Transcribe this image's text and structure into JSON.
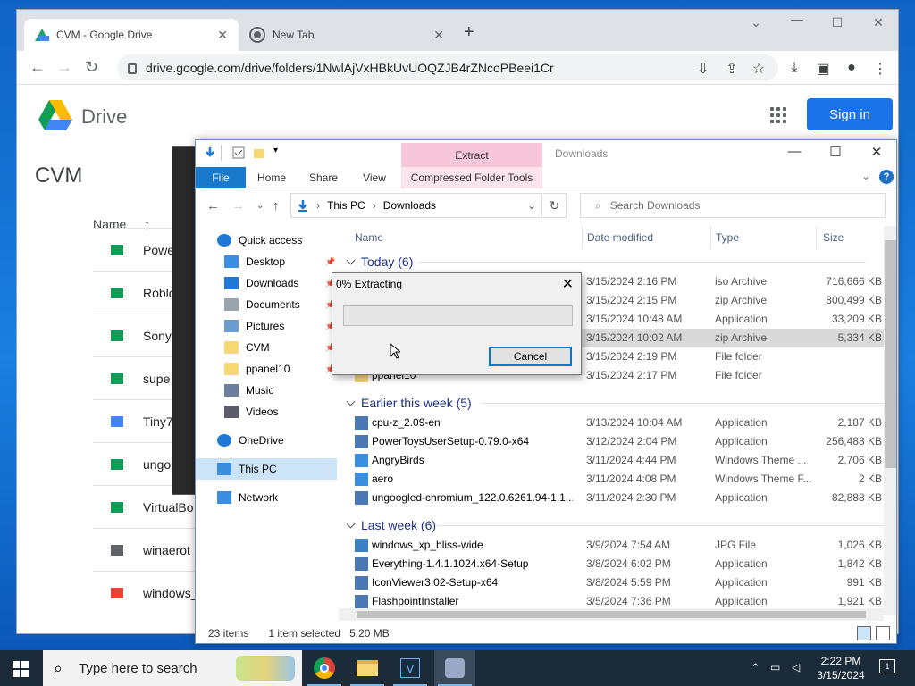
{
  "browser": {
    "tabs": [
      {
        "title": "CVM - Google Drive",
        "active": true
      },
      {
        "title": "New Tab",
        "active": false
      }
    ],
    "url": "drive.google.com/drive/folders/1NwlAjVxHBkUvUOQZJB4rZNcoPBeei1Cr",
    "drive": {
      "product": "Drive",
      "sign_in": "Sign in",
      "folder": "CVM",
      "name_header": "Name",
      "sort_arrow": "↑",
      "rows": [
        "Powe",
        "Roblo",
        "Sony",
        "supe",
        "Tiny7",
        "ungo",
        "VirtualBo",
        "winaerot",
        "windows_"
      ]
    }
  },
  "explorer": {
    "title": "Downloads",
    "context_tab": "Extract",
    "ribbon_tabs": [
      "File",
      "Home",
      "Share",
      "View",
      "Compressed Folder Tools"
    ],
    "address": [
      "This PC",
      "Downloads"
    ],
    "search_placeholder": "Search Downloads",
    "columns": {
      "name": "Name",
      "date": "Date modified",
      "type": "Type",
      "size": "Size"
    },
    "sidebar": [
      {
        "label": "Quick access",
        "icon": "star-icon"
      },
      {
        "label": "Desktop",
        "icon": "desktop-icon",
        "pinned": true
      },
      {
        "label": "Downloads",
        "icon": "download-icon",
        "pinned": true
      },
      {
        "label": "Documents",
        "icon": "documents-icon",
        "pinned": true
      },
      {
        "label": "Pictures",
        "icon": "pictures-icon",
        "pinned": true
      },
      {
        "label": "CVM",
        "icon": "folder-icon",
        "pinned": true
      },
      {
        "label": "ppanel10",
        "icon": "folder-icon",
        "pinned": true
      },
      {
        "label": "Music",
        "icon": "music-icon"
      },
      {
        "label": "Videos",
        "icon": "videos-icon"
      },
      {
        "label": "OneDrive",
        "icon": "cloud-icon"
      },
      {
        "label": "This PC",
        "icon": "pc-icon",
        "selected": true
      },
      {
        "label": "Network",
        "icon": "network-icon"
      }
    ],
    "groups": [
      {
        "label": "Today (6)",
        "rows": [
          {
            "name": "",
            "date": "3/15/2024 2:16 PM",
            "type": "iso Archive",
            "size": "716,666 KB",
            "icon": "archive"
          },
          {
            "name": "",
            "date": "3/15/2024 2:15 PM",
            "type": "zip Archive",
            "size": "800,499 KB",
            "icon": "archive"
          },
          {
            "name": "",
            "date": "3/15/2024 10:48 AM",
            "type": "Application",
            "size": "33,209 KB",
            "icon": "app"
          },
          {
            "name": "",
            "date": "3/15/2024 10:02 AM",
            "type": "zip Archive",
            "size": "5,334 KB",
            "icon": "archive",
            "selected": true
          },
          {
            "name": "",
            "date": "3/15/2024 2:19 PM",
            "type": "File folder",
            "size": "",
            "icon": "folder"
          },
          {
            "name": "ppanel10",
            "date": "3/15/2024 2:17 PM",
            "type": "File folder",
            "size": "",
            "icon": "folder"
          }
        ]
      },
      {
        "label": "Earlier this week (5)",
        "rows": [
          {
            "name": "cpu-z_2.09-en",
            "date": "3/13/2024 10:04 AM",
            "type": "Application",
            "size": "2,187 KB",
            "icon": "app"
          },
          {
            "name": "PowerToysUserSetup-0.79.0-x64",
            "date": "3/12/2024 2:04 PM",
            "type": "Application",
            "size": "256,488 KB",
            "icon": "app"
          },
          {
            "name": "AngryBirds",
            "date": "3/11/2024 4:44 PM",
            "type": "Windows Theme ...",
            "size": "2,706 KB",
            "icon": "theme"
          },
          {
            "name": "aero",
            "date": "3/11/2024 4:08 PM",
            "type": "Windows Theme F...",
            "size": "2 KB",
            "icon": "theme"
          },
          {
            "name": "ungoogled-chromium_122.0.6261.94-1.1...",
            "date": "3/11/2024 2:30 PM",
            "type": "Application",
            "size": "82,888 KB",
            "icon": "app"
          }
        ]
      },
      {
        "label": "Last week (6)",
        "rows": [
          {
            "name": "windows_xp_bliss-wide",
            "date": "3/9/2024 7:54 AM",
            "type": "JPG File",
            "size": "1,026 KB",
            "icon": "image"
          },
          {
            "name": "Everything-1.4.1.1024.x64-Setup",
            "date": "3/8/2024 6:02 PM",
            "type": "Application",
            "size": "1,842 KB",
            "icon": "app"
          },
          {
            "name": "IconViewer3.02-Setup-x64",
            "date": "3/8/2024 5:59 PM",
            "type": "Application",
            "size": "991 KB",
            "icon": "app"
          },
          {
            "name": "FlashpointInstaller",
            "date": "3/5/2024 7:36 PM",
            "type": "Application",
            "size": "1,921 KB",
            "icon": "app"
          }
        ]
      }
    ],
    "status": {
      "items": "23 items",
      "selected": "1 item selected",
      "size": "5.20 MB"
    }
  },
  "dialog": {
    "title": "0% Extracting",
    "progress": 0,
    "cancel": "Cancel"
  },
  "taskbar": {
    "search_placeholder": "Type here to search",
    "time": "2:22 PM",
    "date": "3/15/2024",
    "notifications": "1"
  }
}
